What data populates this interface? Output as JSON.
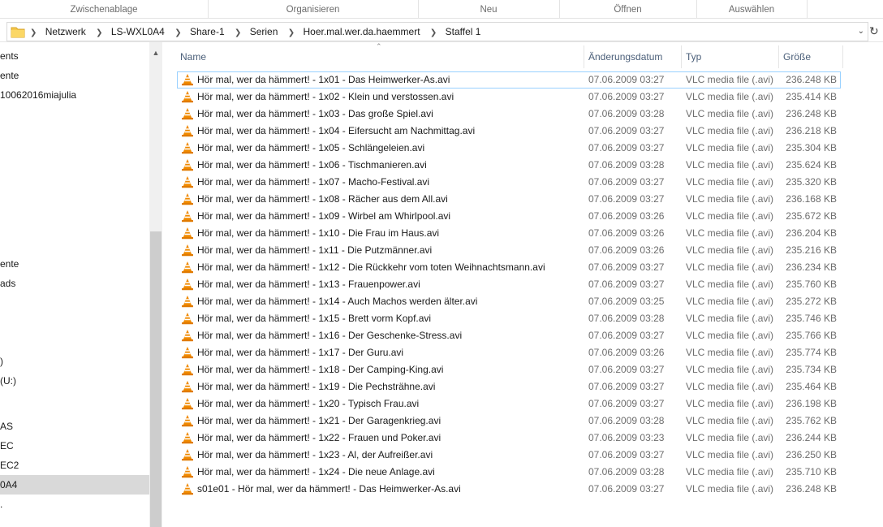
{
  "ribbon": {
    "groups": [
      "Zwischenablage",
      "Organisieren",
      "Neu",
      "Öffnen",
      "Auswählen"
    ]
  },
  "address": {
    "breadcrumbs": [
      "Netzwerk",
      "LS-WXL0A4",
      "Share-1",
      "Serien",
      "Hoer.mal.wer.da.haemmert",
      "Staffel 1"
    ],
    "dropdown_icon": "chevron-down-icon",
    "refresh_icon": "refresh-icon"
  },
  "nav": {
    "items": [
      {
        "label": "ents",
        "selected": false
      },
      {
        "label": "ente",
        "selected": false
      },
      {
        "label": "10062016miajulia",
        "selected": false
      },
      {
        "label": "ente",
        "selected": false
      },
      {
        "label": "ads",
        "selected": false
      },
      {
        "label": ")",
        "selected": false
      },
      {
        "label": " (U:)",
        "selected": false
      },
      {
        "label": "AS",
        "selected": false
      },
      {
        "label": "EC",
        "selected": false
      },
      {
        "label": "EC2",
        "selected": false
      },
      {
        "label": "0A4",
        "selected": true
      },
      {
        "label": ".",
        "selected": false
      }
    ]
  },
  "columns": {
    "name": "Name",
    "date": "Änderungsdatum",
    "type": "Typ",
    "size": "Größe"
  },
  "files": [
    {
      "name": "Hör mal, wer da hämmert! - 1x01 - Das Heimwerker-As.avi",
      "date": "07.06.2009 03:27",
      "type": "VLC media file (.avi)",
      "size": "236.248 KB"
    },
    {
      "name": "Hör mal, wer da hämmert! - 1x02 - Klein und verstossen.avi",
      "date": "07.06.2009 03:27",
      "type": "VLC media file (.avi)",
      "size": "235.414 KB"
    },
    {
      "name": "Hör mal, wer da hämmert! - 1x03 - Das große Spiel.avi",
      "date": "07.06.2009 03:28",
      "type": "VLC media file (.avi)",
      "size": "236.248 KB"
    },
    {
      "name": "Hör mal, wer da hämmert! - 1x04 - Eifersucht am Nachmittag.avi",
      "date": "07.06.2009 03:27",
      "type": "VLC media file (.avi)",
      "size": "236.218 KB"
    },
    {
      "name": "Hör mal, wer da hämmert! - 1x05 - Schlängeleien.avi",
      "date": "07.06.2009 03:27",
      "type": "VLC media file (.avi)",
      "size": "235.304 KB"
    },
    {
      "name": "Hör mal, wer da hämmert! - 1x06 - Tischmanieren.avi",
      "date": "07.06.2009 03:28",
      "type": "VLC media file (.avi)",
      "size": "235.624 KB"
    },
    {
      "name": "Hör mal, wer da hämmert! - 1x07 - Macho-Festival.avi",
      "date": "07.06.2009 03:27",
      "type": "VLC media file (.avi)",
      "size": "235.320 KB"
    },
    {
      "name": "Hör mal, wer da hämmert! - 1x08 - Rächer aus dem All.avi",
      "date": "07.06.2009 03:27",
      "type": "VLC media file (.avi)",
      "size": "236.168 KB"
    },
    {
      "name": "Hör mal, wer da hämmert! - 1x09 - Wirbel am Whirlpool.avi",
      "date": "07.06.2009 03:26",
      "type": "VLC media file (.avi)",
      "size": "235.672 KB"
    },
    {
      "name": "Hör mal, wer da hämmert! - 1x10 - Die Frau im Haus.avi",
      "date": "07.06.2009 03:26",
      "type": "VLC media file (.avi)",
      "size": "236.204 KB"
    },
    {
      "name": "Hör mal, wer da hämmert! - 1x11 - Die Putzmänner.avi",
      "date": "07.06.2009 03:26",
      "type": "VLC media file (.avi)",
      "size": "235.216 KB"
    },
    {
      "name": "Hör mal, wer da hämmert! - 1x12 - Die Rückkehr vom toten Weihnachtsmann.avi",
      "date": "07.06.2009 03:27",
      "type": "VLC media file (.avi)",
      "size": "236.234 KB"
    },
    {
      "name": "Hör mal, wer da hämmert! - 1x13 - Frauenpower.avi",
      "date": "07.06.2009 03:27",
      "type": "VLC media file (.avi)",
      "size": "235.760 KB"
    },
    {
      "name": "Hör mal, wer da hämmert! - 1x14 - Auch Machos werden älter.avi",
      "date": "07.06.2009 03:25",
      "type": "VLC media file (.avi)",
      "size": "235.272 KB"
    },
    {
      "name": "Hör mal, wer da hämmert! - 1x15 - Brett vorm Kopf.avi",
      "date": "07.06.2009 03:28",
      "type": "VLC media file (.avi)",
      "size": "235.746 KB"
    },
    {
      "name": "Hör mal, wer da hämmert! - 1x16 - Der Geschenke-Stress.avi",
      "date": "07.06.2009 03:27",
      "type": "VLC media file (.avi)",
      "size": "235.766 KB"
    },
    {
      "name": "Hör mal, wer da hämmert! - 1x17 - Der Guru.avi",
      "date": "07.06.2009 03:26",
      "type": "VLC media file (.avi)",
      "size": "235.774 KB"
    },
    {
      "name": "Hör mal, wer da hämmert! - 1x18 - Der Camping-King.avi",
      "date": "07.06.2009 03:27",
      "type": "VLC media file (.avi)",
      "size": "235.734 KB"
    },
    {
      "name": "Hör mal, wer da hämmert! - 1x19 - Die Pechsträhne.avi",
      "date": "07.06.2009 03:27",
      "type": "VLC media file (.avi)",
      "size": "235.464 KB"
    },
    {
      "name": "Hör mal, wer da hämmert! - 1x20 - Typisch Frau.avi",
      "date": "07.06.2009 03:27",
      "type": "VLC media file (.avi)",
      "size": "236.198 KB"
    },
    {
      "name": "Hör mal, wer da hämmert! - 1x21 - Der Garagenkrieg.avi",
      "date": "07.06.2009 03:28",
      "type": "VLC media file (.avi)",
      "size": "235.762 KB"
    },
    {
      "name": "Hör mal, wer da hämmert! - 1x22 - Frauen und Poker.avi",
      "date": "07.06.2009 03:23",
      "type": "VLC media file (.avi)",
      "size": "236.244 KB"
    },
    {
      "name": "Hör mal, wer da hämmert! - 1x23 - Al, der Aufreißer.avi",
      "date": "07.06.2009 03:27",
      "type": "VLC media file (.avi)",
      "size": "236.250 KB"
    },
    {
      "name": "Hör mal, wer da hämmert! - 1x24 - Die neue Anlage.avi",
      "date": "07.06.2009 03:28",
      "type": "VLC media file (.avi)",
      "size": "235.710 KB"
    },
    {
      "name": "s01e01 - Hör mal, wer da hämmert! - Das Heimwerker-As.avi",
      "date": "07.06.2009 03:27",
      "type": "VLC media file (.avi)",
      "size": "236.248 KB"
    }
  ],
  "colors": {
    "vlc_orange": "#f08a00",
    "header_text": "#4c607a",
    "selection_gray": "#d9d9d9",
    "focus_outline": "#99d1ff"
  }
}
